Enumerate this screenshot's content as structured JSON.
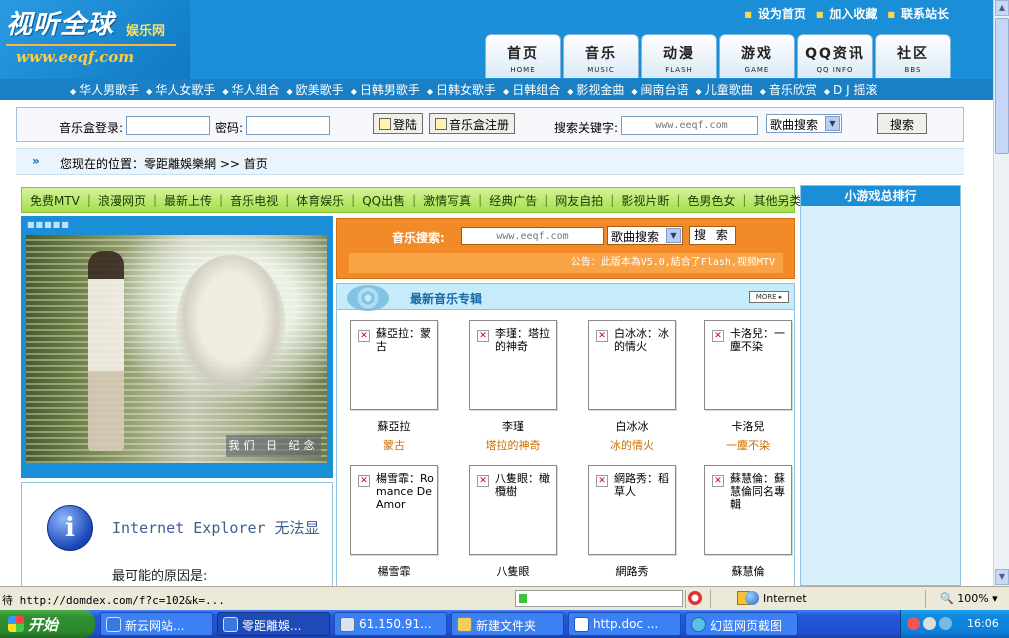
{
  "site": {
    "logo_title": "视听全球",
    "logo_subtitle": "娱乐网",
    "logo_url": "www.eeqf.com",
    "top_links": [
      "设为首页",
      "加入收藏",
      "联系站长"
    ],
    "nav_tabs": [
      {
        "cn": "首页",
        "en": "HOME"
      },
      {
        "cn": "音乐",
        "en": "MUSIC"
      },
      {
        "cn": "动漫",
        "en": "FLASH"
      },
      {
        "cn": "游戏",
        "en": "GAME"
      },
      {
        "cn": "QQ资讯",
        "en": "QQ INFO"
      },
      {
        "cn": "社区",
        "en": "BBS"
      }
    ]
  },
  "categories": [
    "华人男歌手",
    "华人女歌手",
    "华人组合",
    "欧美歌手",
    "日韩男歌手",
    "日韩女歌手",
    "日韩组合",
    "影视金曲",
    "闽南台语",
    "儿童歌曲",
    "音乐欣赏",
    "D J 摇滚"
  ],
  "login": {
    "user_label": "音乐盒登录:",
    "password_label": "密码:",
    "login_button": "登陆",
    "register_button": "音乐盒注册",
    "search_label": "搜索关键字:",
    "search_placeholder": "www.eeqf.com",
    "search_type": "歌曲搜索",
    "search_button": "搜索"
  },
  "breadcrumb": {
    "arrow": "»",
    "text": "您现在的位置：零距離娛樂網 >> 首页"
  },
  "subnav": [
    "免费MTV",
    "浪漫网页",
    "最新上传",
    "音乐电视",
    "体育娱乐",
    "QQ出售",
    "激情写真",
    "经典广告",
    "网友自拍",
    "影视片断",
    "色男色女",
    "其他另类"
  ],
  "sidebar": {
    "title": "小游戏总排行"
  },
  "photo": {
    "caption": "我们 日 纪念"
  },
  "ie_error": {
    "title": "Internet Explorer 无法显",
    "reason": "最可能的原因是:"
  },
  "music_search": {
    "label": "音乐搜索:",
    "placeholder": "www.eeqf.com",
    "type": "歌曲搜索",
    "button": "搜 索",
    "notice": "公告：此版本為V5.0,結合了Flash,视频MTV"
  },
  "albums": {
    "header": "最新音乐专辑",
    "more": "MORE",
    "items": [
      {
        "alt": "蘇亞拉：蒙古",
        "artist": "蘇亞拉",
        "title": "蒙古"
      },
      {
        "alt": "李瑾：塔拉的神奇",
        "artist": "李瑾",
        "title": "塔拉的神奇"
      },
      {
        "alt": "白冰冰：冰的情火",
        "artist": "白冰冰",
        "title": "冰的情火"
      },
      {
        "alt": "卡洛兒：一塵不染",
        "artist": "卡洛兒",
        "title": "一塵不染"
      },
      {
        "alt": "楊雪霏：Romance De Amor",
        "artist": "楊雪霏",
        "title": ""
      },
      {
        "alt": "八隻眼：橄欖樹",
        "artist": "八隻眼",
        "title": ""
      },
      {
        "alt": "網路秀：稻草人",
        "artist": "網路秀",
        "title": ""
      },
      {
        "alt": "蘇慧倫：蘇慧倫同名專輯",
        "artist": "蘇慧倫",
        "title": ""
      }
    ]
  },
  "statusbar": {
    "text": "待 http://domdex.com/f?c=102&k=...",
    "progress": 0.05,
    "zone": "Internet",
    "zoom": "100%"
  },
  "taskbar": {
    "start": "开始",
    "tasks": [
      "新云网站...",
      "零距離娛...",
      "61.150.91...",
      "新建文件夹",
      "http.doc ...",
      "幻蓝网页截图"
    ],
    "time": "16:06"
  }
}
